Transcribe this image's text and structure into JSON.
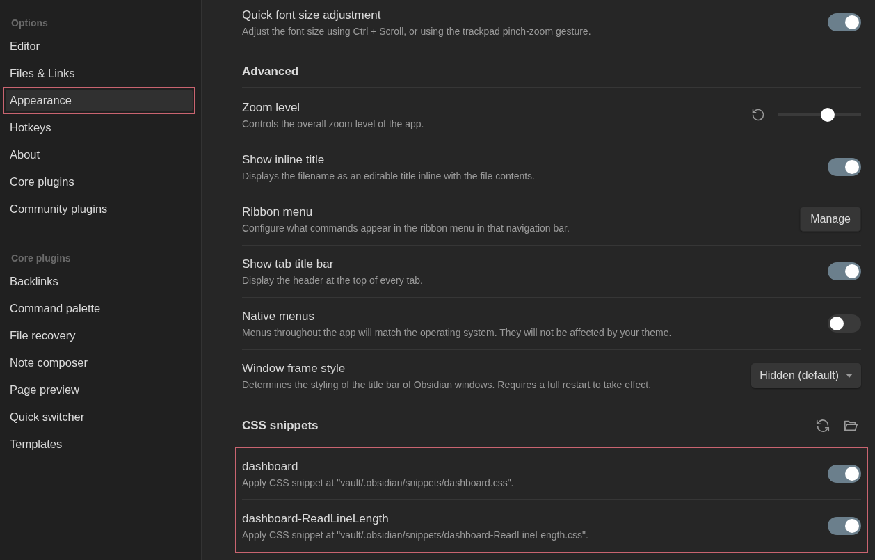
{
  "sidebar": {
    "sections": [
      {
        "heading": "Options",
        "items": [
          {
            "label": "Editor",
            "selected": false,
            "highlighted": false
          },
          {
            "label": "Files & Links",
            "selected": false,
            "highlighted": false
          },
          {
            "label": "Appearance",
            "selected": true,
            "highlighted": true
          },
          {
            "label": "Hotkeys",
            "selected": false,
            "highlighted": false
          },
          {
            "label": "About",
            "selected": false,
            "highlighted": false
          },
          {
            "label": "Core plugins",
            "selected": false,
            "highlighted": false
          },
          {
            "label": "Community plugins",
            "selected": false,
            "highlighted": false
          }
        ]
      },
      {
        "heading": "Core plugins",
        "items": [
          {
            "label": "Backlinks",
            "selected": false,
            "highlighted": false
          },
          {
            "label": "Command palette",
            "selected": false,
            "highlighted": false
          },
          {
            "label": "File recovery",
            "selected": false,
            "highlighted": false
          },
          {
            "label": "Note composer",
            "selected": false,
            "highlighted": false
          },
          {
            "label": "Page preview",
            "selected": false,
            "highlighted": false
          },
          {
            "label": "Quick switcher",
            "selected": false,
            "highlighted": false
          },
          {
            "label": "Templates",
            "selected": false,
            "highlighted": false
          }
        ]
      }
    ]
  },
  "sections": [
    {
      "kind": "plain",
      "highlighted": false,
      "settings": [
        {
          "name": "Quick font size adjustment",
          "description": "Adjust the font size using Ctrl + Scroll, or using the trackpad pinch-zoom gesture.",
          "control": {
            "kind": "toggle",
            "on": true
          }
        }
      ]
    },
    {
      "kind": "plain",
      "heading": "Advanced",
      "highlighted": false,
      "settings": [
        {
          "name": "Zoom level",
          "description": "Controls the overall zoom level of the app.",
          "control": {
            "kind": "slider",
            "level": 0.6
          }
        },
        {
          "name": "Show inline title",
          "description": "Displays the filename as an editable title inline with the file contents.",
          "control": {
            "kind": "toggle",
            "on": true
          }
        },
        {
          "name": "Ribbon menu",
          "description": "Configure what commands appear in the ribbon menu in that navigation bar.",
          "control": {
            "kind": "button",
            "label": "Manage"
          }
        },
        {
          "name": "Show tab title bar",
          "description": "Display the header at the top of every tab.",
          "control": {
            "kind": "toggle",
            "on": true
          }
        },
        {
          "name": "Native menus",
          "description": "Menus throughout the app will match the operating system. They will not be affected by your theme.",
          "control": {
            "kind": "toggle",
            "on": false
          }
        },
        {
          "name": "Window frame style",
          "description": "Determines the styling of the title bar of Obsidian windows. Requires a full restart to take effect.",
          "control": {
            "kind": "dropdown",
            "value": "Hidden (default)"
          }
        }
      ]
    },
    {
      "kind": "snippets",
      "heading": "CSS snippets",
      "highlighted": true,
      "settings": [
        {
          "name": "dashboard",
          "description": "Apply CSS snippet at \"vault/.obsidian/snippets/dashboard.css\".",
          "control": {
            "kind": "toggle",
            "on": true
          }
        },
        {
          "name": "dashboard-ReadLineLength",
          "description": "Apply CSS snippet at \"vault/.obsidian/snippets/dashboard-ReadLineLength.css\".",
          "control": {
            "kind": "toggle",
            "on": true
          }
        }
      ]
    }
  ]
}
